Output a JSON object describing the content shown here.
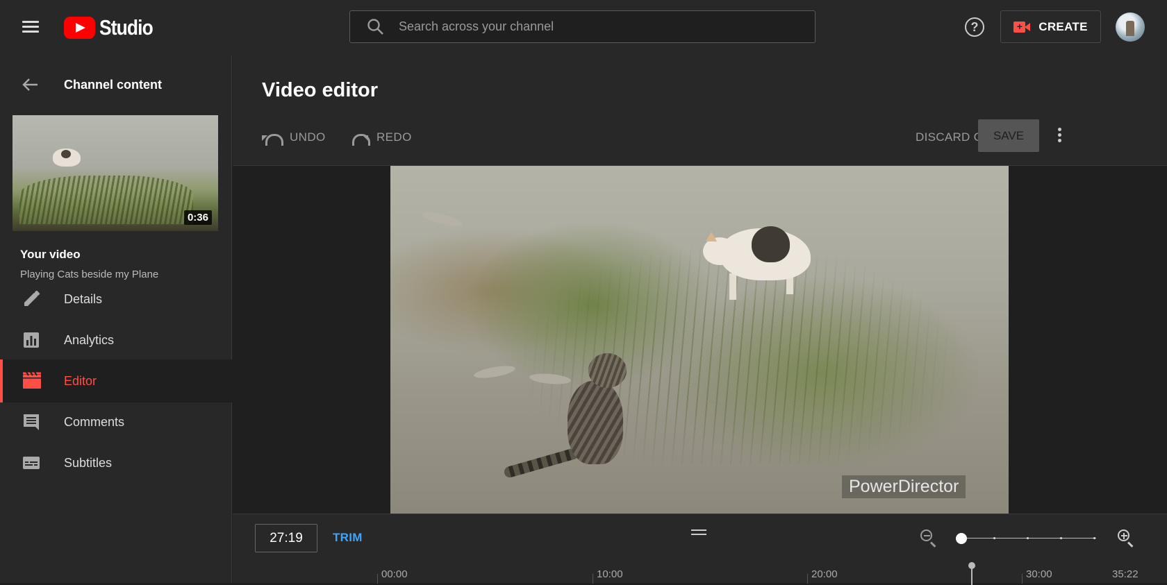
{
  "header": {
    "logo_text": "Studio",
    "search_placeholder": "Search across your channel",
    "help_label": "?",
    "create_label": "CREATE"
  },
  "sidebar": {
    "back_label": "Channel content",
    "thumbnail_duration": "0:36",
    "section_label": "Your video",
    "video_title": "Playing Cats beside my Plane",
    "items": [
      {
        "label": "Details",
        "icon": "pencil-icon",
        "active": false
      },
      {
        "label": "Analytics",
        "icon": "analytics-icon",
        "active": false
      },
      {
        "label": "Editor",
        "icon": "editor-icon",
        "active": true
      },
      {
        "label": "Comments",
        "icon": "comments-icon",
        "active": false
      },
      {
        "label": "Subtitles",
        "icon": "subtitles-icon",
        "active": false
      }
    ]
  },
  "main": {
    "title": "Video editor",
    "undo_label": "UNDO",
    "redo_label": "REDO",
    "discard_label": "DISCARD CHANGES",
    "save_label": "SAVE",
    "watermark": "PowerDirector"
  },
  "timeline": {
    "current_time": "27:19",
    "trim_label": "TRIM",
    "ruler_labels": [
      "00:00",
      "10:00",
      "20:00",
      "30:00",
      "35:22"
    ]
  },
  "colors": {
    "accent_red": "#ff4e45",
    "link_blue": "#3ea6ff",
    "background": "#282828"
  }
}
